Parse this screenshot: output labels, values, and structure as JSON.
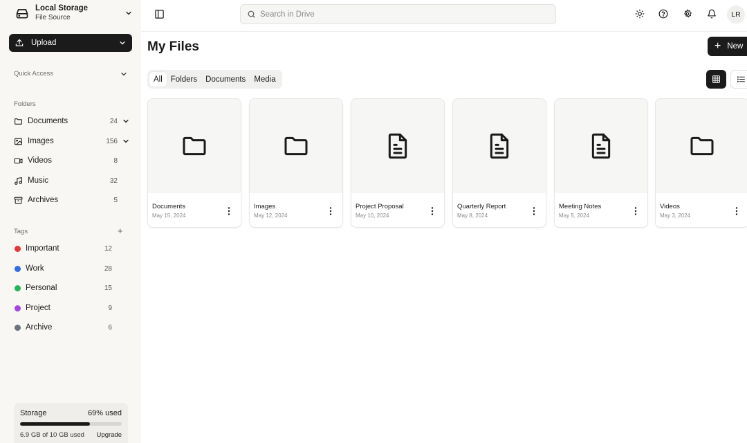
{
  "source": {
    "name": "Local Storage",
    "subtitle": "File Source"
  },
  "upload_label": "Upload",
  "quick_access_label": "Quick Access",
  "folders_label": "Folders",
  "folders": [
    {
      "label": "Documents",
      "count": "24",
      "icon": "folder-icon"
    },
    {
      "label": "Images",
      "count": "156",
      "icon": "image-icon"
    },
    {
      "label": "Videos",
      "count": "8",
      "icon": "video-icon"
    },
    {
      "label": "Music",
      "count": "32",
      "icon": "music-icon"
    },
    {
      "label": "Archives",
      "count": "5",
      "icon": "archive-icon"
    }
  ],
  "tags_label": "Tags",
  "tags_add": "+",
  "tags": [
    {
      "label": "Important",
      "count": "12",
      "color": "#e5383b"
    },
    {
      "label": "Work",
      "count": "28",
      "color": "#2f6fe4"
    },
    {
      "label": "Personal",
      "count": "15",
      "color": "#22b55a"
    },
    {
      "label": "Project",
      "count": "9",
      "color": "#a546e0"
    },
    {
      "label": "Archive",
      "count": "6",
      "color": "#6b7280"
    }
  ],
  "storage": {
    "label": "Storage",
    "percent_text": "69% used",
    "used_fraction": 0.69,
    "detail": "6.9 GB of 10 GB used",
    "upgrade": "Upgrade"
  },
  "search": {
    "placeholder": "Search in Drive"
  },
  "avatar": "LR",
  "page_title": "My Files",
  "new_label": "New",
  "filter_tabs": [
    "All",
    "Folders",
    "Documents",
    "Media"
  ],
  "active_tab": "All",
  "files": [
    {
      "name": "Documents",
      "date": "May 15, 2024",
      "type": "folder"
    },
    {
      "name": "Images",
      "date": "May 12, 2024",
      "type": "folder"
    },
    {
      "name": "Project Proposal",
      "date": "May 10, 2024",
      "type": "document"
    },
    {
      "name": "Quarterly Report",
      "date": "May 8, 2024",
      "type": "document"
    },
    {
      "name": "Meeting Notes",
      "date": "May 5, 2024",
      "type": "document"
    },
    {
      "name": "Videos",
      "date": "May 3, 2024",
      "type": "folder"
    }
  ],
  "colors": {
    "accent": "#1b1b1b",
    "sidebar_bg": "#f8f7f4"
  }
}
